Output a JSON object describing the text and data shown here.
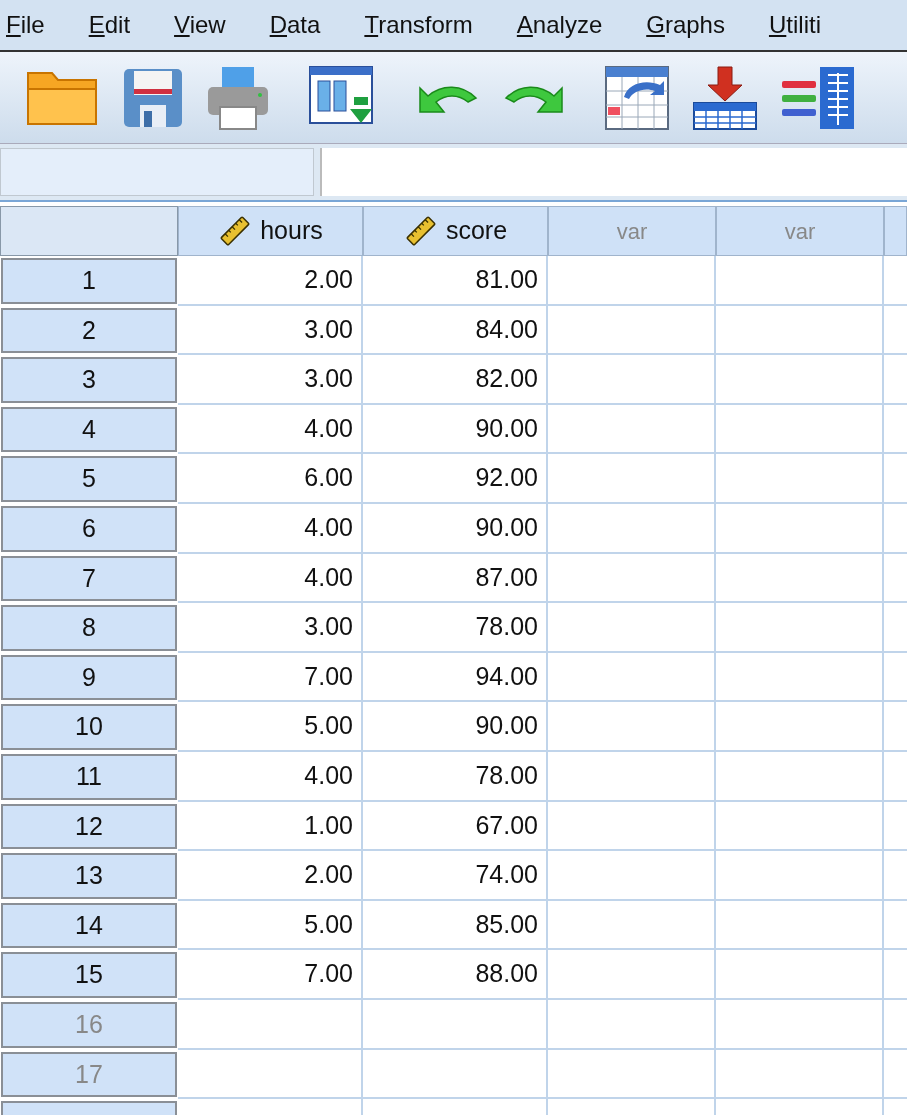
{
  "menu": [
    "File",
    "Edit",
    "View",
    "Data",
    "Transform",
    "Analyze",
    "Graphs",
    "Utiliti"
  ],
  "columns": [
    {
      "label": "hours",
      "kind": "variable"
    },
    {
      "label": "score",
      "kind": "variable"
    },
    {
      "label": "var",
      "kind": "placeholder"
    },
    {
      "label": "var",
      "kind": "placeholder"
    }
  ],
  "rows": [
    {
      "number": "1",
      "has_data": true,
      "cells": [
        "2.00",
        "81.00"
      ]
    },
    {
      "number": "2",
      "has_data": true,
      "cells": [
        "3.00",
        "84.00"
      ]
    },
    {
      "number": "3",
      "has_data": true,
      "cells": [
        "3.00",
        "82.00"
      ]
    },
    {
      "number": "4",
      "has_data": true,
      "cells": [
        "4.00",
        "90.00"
      ]
    },
    {
      "number": "5",
      "has_data": true,
      "cells": [
        "6.00",
        "92.00"
      ]
    },
    {
      "number": "6",
      "has_data": true,
      "cells": [
        "4.00",
        "90.00"
      ]
    },
    {
      "number": "7",
      "has_data": true,
      "cells": [
        "4.00",
        "87.00"
      ]
    },
    {
      "number": "8",
      "has_data": true,
      "cells": [
        "3.00",
        "78.00"
      ]
    },
    {
      "number": "9",
      "has_data": true,
      "cells": [
        "7.00",
        "94.00"
      ]
    },
    {
      "number": "10",
      "has_data": true,
      "cells": [
        "5.00",
        "90.00"
      ]
    },
    {
      "number": "11",
      "has_data": true,
      "cells": [
        "4.00",
        "78.00"
      ]
    },
    {
      "number": "12",
      "has_data": true,
      "cells": [
        "1.00",
        "67.00"
      ]
    },
    {
      "number": "13",
      "has_data": true,
      "cells": [
        "2.00",
        "74.00"
      ]
    },
    {
      "number": "14",
      "has_data": true,
      "cells": [
        "5.00",
        "85.00"
      ]
    },
    {
      "number": "15",
      "has_data": true,
      "cells": [
        "7.00",
        "88.00"
      ]
    },
    {
      "number": "16",
      "has_data": false,
      "cells": []
    },
    {
      "number": "17",
      "has_data": false,
      "cells": []
    }
  ]
}
